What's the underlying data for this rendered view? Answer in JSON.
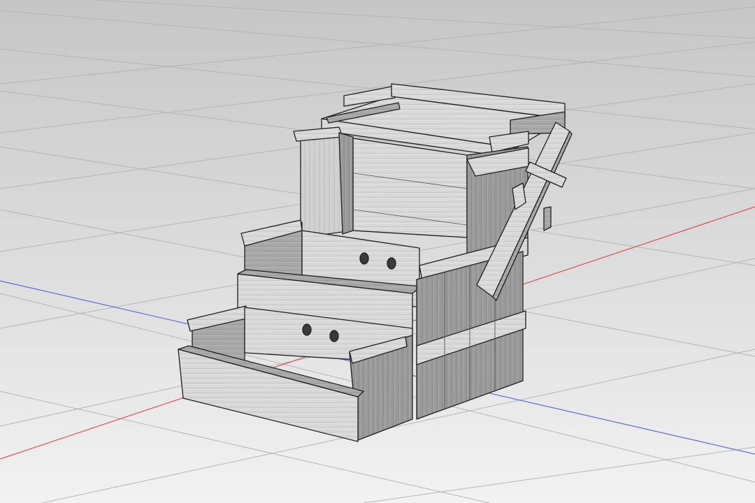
{
  "viewport": {
    "view": "perspective",
    "display_mode": "shaded-wood-texture",
    "background_top": "#c6c6c6",
    "background_bottom": "#f2f2f2",
    "grid_color": "#b5b5b5",
    "axes": {
      "x_axis_color": "#e05050",
      "y_axis_color": "#5a6ee0"
    }
  },
  "model": {
    "object": "wooden-step-box-with-hinged-lever",
    "material": "light-grey-wood-grain",
    "parts": [
      "top-tray",
      "back-frame",
      "upper-step",
      "lower-step",
      "side-crate",
      "hinged-lever"
    ],
    "holes_per_step": 2
  }
}
